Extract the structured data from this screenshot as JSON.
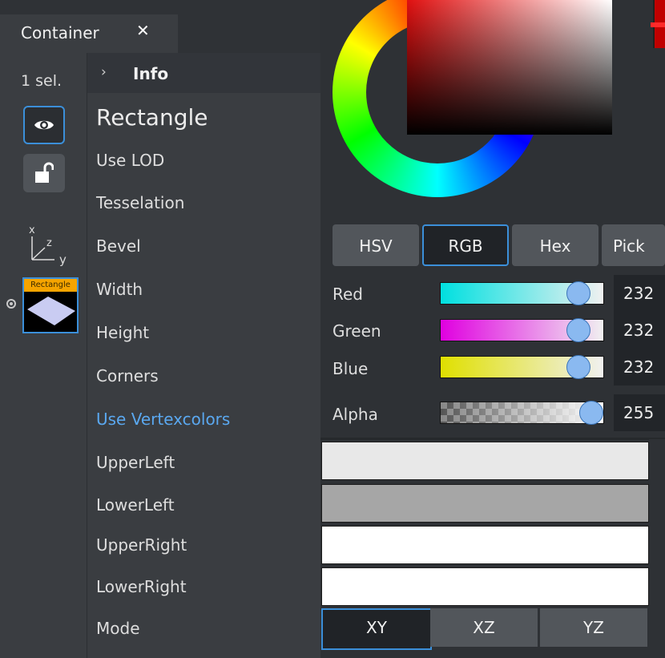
{
  "tab": {
    "title": "Container",
    "close": "✕"
  },
  "left": {
    "selection": "1 sel.",
    "thumb_label": "Rectangle",
    "axes": {
      "x": "x",
      "z": "z",
      "y": "y"
    }
  },
  "properties": {
    "info": "Info",
    "title": "Rectangle",
    "items": [
      "Use LOD",
      "Tesselation",
      "Bevel",
      "Width",
      "Height",
      "Corners",
      "Use Vertexcolors",
      "UpperLeft",
      "LowerLeft",
      "UpperRight",
      "LowerRight",
      "Mode"
    ]
  },
  "color_picker": {
    "modes": [
      "HSV",
      "RGB",
      "Hex",
      "Pick"
    ],
    "active_mode": "RGB",
    "channels": [
      {
        "label": "Red",
        "value": "232",
        "level": 0.91
      },
      {
        "label": "Green",
        "value": "232",
        "level": 0.91
      },
      {
        "label": "Blue",
        "value": "232",
        "level": 0.91
      },
      {
        "label": "Alpha",
        "value": "255",
        "level": 1.0
      }
    ]
  },
  "vertex_colors": {
    "upper_left": "#e8e8e8",
    "lower_left": "#a6a6a6",
    "upper_right": "#ffffff",
    "lower_right": "#ffffff"
  },
  "mode_buttons": {
    "options": [
      "XY",
      "XZ",
      "YZ"
    ],
    "active": "XY"
  },
  "colors": {
    "accent": "#3b8fd9",
    "link": "#5aa8f0",
    "thumb_label_bg": "#f5a400"
  },
  "icons": {
    "eye": "eye-icon",
    "lock": "unlock-icon",
    "chevron": "chevron-right-icon"
  }
}
